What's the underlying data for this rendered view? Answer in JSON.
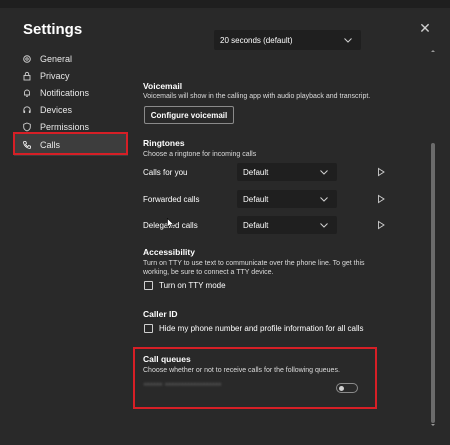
{
  "dialog": {
    "title": "Settings",
    "close_glyph": "✕"
  },
  "sidebar": {
    "items": [
      {
        "label": "General",
        "icon": "gear-icon"
      },
      {
        "label": "Privacy",
        "icon": "lock-icon"
      },
      {
        "label": "Notifications",
        "icon": "bell-icon"
      },
      {
        "label": "Devices",
        "icon": "headset-icon"
      },
      {
        "label": "Permissions",
        "icon": "shield-icon"
      },
      {
        "label": "Calls",
        "icon": "phone-icon",
        "active": true
      }
    ]
  },
  "top_dropdown": {
    "value": "20 seconds (default)"
  },
  "voicemail": {
    "heading": "Voicemail",
    "description": "Voicemails will show in the calling app with audio playback and transcript.",
    "button_label": "Configure voicemail"
  },
  "ringtones": {
    "heading": "Ringtones",
    "description": "Choose a ringtone for incoming calls",
    "rows": [
      {
        "label": "Calls for you",
        "value": "Default"
      },
      {
        "label": "Forwarded calls",
        "value": "Default"
      },
      {
        "label": "Delegated calls",
        "value": "Default"
      }
    ]
  },
  "accessibility": {
    "heading": "Accessibility",
    "description_line1": "Turn on TTY to use text to communicate over the phone line. To get this",
    "description_line2": "working, be sure to connect a TTY device.",
    "checkbox_label": "Turn on TTY mode"
  },
  "caller_id": {
    "heading": "Caller ID",
    "checkbox_label": "Hide my phone number and profile information for all calls"
  },
  "call_queues": {
    "heading": "Call queues",
    "description": "Choose whether or not to receive calls for the following queues.",
    "queue_name_redacted": "▪▪▪▪▪▪ ▪▪▪▪▪▪▪▪▪▪▪▪▪▪▪▪▪▪",
    "toggle_on": false
  },
  "colors": {
    "accent_red": "#d61f26",
    "background": "#292929",
    "input_bg": "#1f1f1f"
  }
}
